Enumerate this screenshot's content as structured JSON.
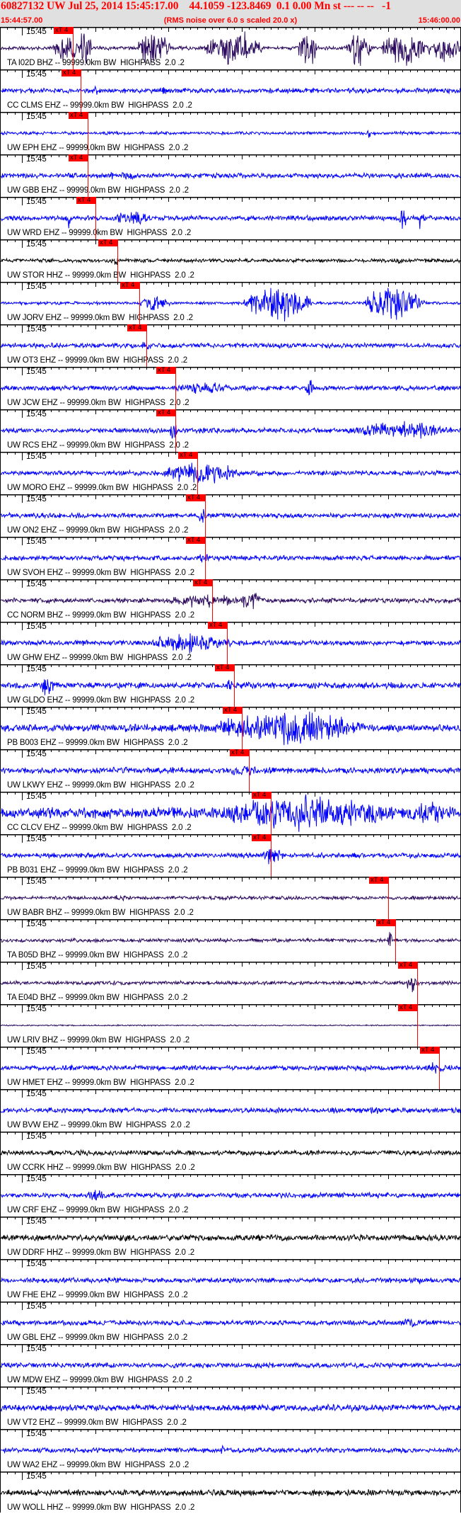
{
  "header": {
    "title": "60827132 UW Jul 25, 2014 15:45:17.00    44.1059 -123.8469  0.1 0.00 Mn st --- -- --   -1",
    "start_time": "15:44:57.00",
    "note": "(RMS noise over 6.0 s scaled 20.0 x)",
    "end_time": "15:46:00.00"
  },
  "axis": {
    "window_seconds": 63,
    "minute_label": "15:45",
    "minute_offset_s": 3
  },
  "pick_label": "xT 4",
  "traces": [
    {
      "label": "TA I02D BHZ -- 99999.0km BW  HIGHPASS  2.0 .2",
      "color": "#2b0a5e",
      "pick_s": 10
    },
    {
      "label": "CC CLMS EHZ -- 99999.0km BW  HIGHPASS  2.0 .2",
      "color": "#0000ff",
      "pick_s": 11
    },
    {
      "label": "UW EPH EHZ -- 99999.0km BW  HIGHPASS  2.0 .2",
      "color": "#0000ff",
      "pick_s": 12
    },
    {
      "label": "UW GBB EHZ -- 99999.0km BW  HIGHPASS  2.0 .2",
      "color": "#0000ff",
      "pick_s": 12
    },
    {
      "label": "UW WRD EHZ -- 99999.0km BW  HIGHPASS  2.0 .2",
      "color": "#0000ff",
      "pick_s": 13
    },
    {
      "label": "UW STOR HHZ -- 99999.0km BW  HIGHPASS  2.0 .2",
      "color": "#000000",
      "pick_s": 16
    },
    {
      "label": "UW JORV EHZ -- 99999.0km BW  HIGHPASS  2.0 .2",
      "color": "#0000ff",
      "pick_s": 19
    },
    {
      "label": "UW OT3 EHZ -- 99999.0km BW  HIGHPASS  2.0 .2",
      "color": "#0000ff",
      "pick_s": 20
    },
    {
      "label": "UW JCW EHZ -- 99999.0km BW  HIGHPASS  2.0 .2",
      "color": "#0000ff",
      "pick_s": 24
    },
    {
      "label": "UW RCS EHZ -- 99999.0km BW  HIGHPASS  2.0 .2",
      "color": "#0000ff",
      "pick_s": 24
    },
    {
      "label": "UW MORO EHZ -- 99999.0km BW  HIGHPASS  2.0 .2",
      "color": "#0000ff",
      "pick_s": 27
    },
    {
      "label": "UW ON2 EHZ -- 99999.0km BW  HIGHPASS  2.0 .2",
      "color": "#0000ff",
      "pick_s": 28
    },
    {
      "label": "UW SVOH EHZ -- 99999.0km BW  HIGHPASS  2.0 .2",
      "color": "#0000ff",
      "pick_s": 28
    },
    {
      "label": "CC NORM BHZ -- 99999.0km BW  HIGHPASS  2.0 .2",
      "color": "#2b0a5e",
      "pick_s": 29
    },
    {
      "label": "UW GHW EHZ -- 99999.0km BW  HIGHPASS  2.0 .2",
      "color": "#0000ff",
      "pick_s": 31
    },
    {
      "label": "UW GLDO EHZ -- 99999.0km BW  HIGHPASS  2.0 .2",
      "color": "#0000ff",
      "pick_s": 32
    },
    {
      "label": "PB B003 EHZ -- 99999.0km BW  HIGHPASS  2.0 .2",
      "color": "#0000ff",
      "pick_s": 33
    },
    {
      "label": "UW LKWY EHZ -- 99999.0km BW  HIGHPASS  2.0 .2",
      "color": "#0000ff",
      "pick_s": 34
    },
    {
      "label": "CC CLCV EHZ -- 99999.0km BW  HIGHPASS  2.0 .2",
      "color": "#0000ff",
      "pick_s": 37
    },
    {
      "label": "PB B031 EHZ -- 99999.0km BW  HIGHPASS  2.0 .2",
      "color": "#0000ff",
      "pick_s": 37
    },
    {
      "label": "UW BABR BHZ -- 99999.0km BW  HIGHPASS  2.0 .2",
      "color": "#2b0a5e",
      "pick_s": 53
    },
    {
      "label": "TA B05D BHZ -- 99999.0km BW  HIGHPASS  2.0 .2",
      "color": "#2b0a5e",
      "pick_s": 54
    },
    {
      "label": "TA E04D BHZ -- 99999.0km BW  HIGHPASS  2.0 .2",
      "color": "#2b0a5e",
      "pick_s": 57
    },
    {
      "label": "UW LRIV BHZ -- 99999.0km BW  HIGHPASS  2.0 .2",
      "color": "#2b0a5e",
      "pick_s": 57
    },
    {
      "label": "UW HMET EHZ -- 99999.0km BW  HIGHPASS  2.0 .2",
      "color": "#0000ff",
      "pick_s": 60
    },
    {
      "label": "UW BVW EHZ -- 99999.0km BW  HIGHPASS  2.0 .2",
      "color": "#0000ff"
    },
    {
      "label": "UW CCRK HHZ -- 99999.0km BW  HIGHPASS  2.0 .2",
      "color": "#000000"
    },
    {
      "label": "UW CRF EHZ -- 99999.0km BW  HIGHPASS  2.0 .2",
      "color": "#0000ff"
    },
    {
      "label": "UW DDRF HHZ -- 99999.0km BW  HIGHPASS  2.0 .2",
      "color": "#000000"
    },
    {
      "label": "UW FHE EHZ -- 99999.0km BW  HIGHPASS  2.0 .2",
      "color": "#0000ff"
    },
    {
      "label": "UW GBL EHZ -- 99999.0km BW  HIGHPASS  2.0 .2",
      "color": "#0000ff"
    },
    {
      "label": "UW MDW EHZ -- 99999.0km BW  HIGHPASS  2.0 .2",
      "color": "#0000ff"
    },
    {
      "label": "UW VT2 EHZ -- 99999.0km BW  HIGHPASS  2.0 .2",
      "color": "#0000ff"
    },
    {
      "label": "UW WA2 EHZ -- 99999.0km BW  HIGHPASS  2.0 .2",
      "color": "#0000ff"
    },
    {
      "label": "UW WOLL HHZ -- 99999.0km BW  HIGHPASS  2.0 .2",
      "color": "#000000"
    }
  ]
}
